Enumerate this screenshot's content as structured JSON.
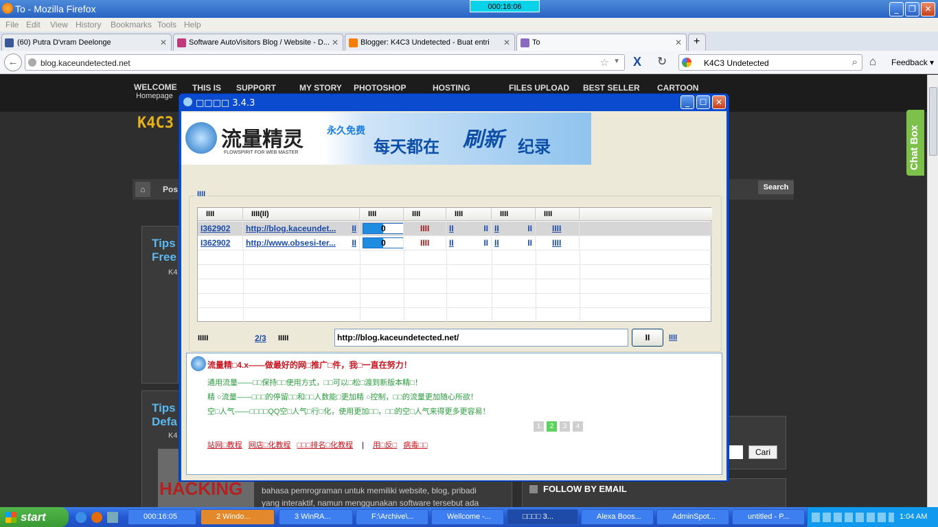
{
  "window": {
    "title": "To - Mozilla Firefox",
    "timer": "000:16:06"
  },
  "menu": [
    "File",
    "Edit",
    "View",
    "History",
    "Bookmarks",
    "Tools",
    "Help"
  ],
  "tabs": [
    {
      "label": "(60) Putra D'vram Deelonge",
      "color": "#3b5998"
    },
    {
      "label": "Software AutoVisitors Blog / Website - D...",
      "color": "#c0397a"
    },
    {
      "label": "Blogger: K4C3 Undetected - Buat entri",
      "color": "#f57d00"
    },
    {
      "label": "To",
      "color": "#8a6ac0"
    }
  ],
  "nav": {
    "url": "blog.kaceundetected.net",
    "search": "K4C3 Undetected",
    "feedback": "Feedback"
  },
  "site": {
    "topnav": [
      {
        "label": "WELCOME",
        "sub": "Homepage"
      },
      {
        "label": "THIS IS",
        "sub": ""
      },
      {
        "label": "SUPPORT",
        "sub": ""
      },
      {
        "label": "MY STORY",
        "sub": ""
      },
      {
        "label": "PHOTOSHOP",
        "sub": ""
      },
      {
        "label": "HOSTING",
        "sub": ""
      },
      {
        "label": "FILES UPLOAD",
        "sub": ""
      },
      {
        "label": "BEST SELLER",
        "sub": ""
      },
      {
        "label": "CARTOON",
        "sub": ""
      }
    ],
    "logo": "K4C3",
    "posts_tab": "Pos",
    "search_btn": "Search",
    "post1_title": "Tips\nFree",
    "post2_title": "Tips\nDefa",
    "post_author": "K4",
    "cari": "Cari",
    "follow": "FOLLOW BY EMAIL",
    "hacking": "HACKING",
    "excerpt1": "bahasa pemrograman untuk memiliki website, blog, pribadi",
    "excerpt2": "yang interaktif, namun menggunakan software tersebut ada",
    "chatbox": "Chat Box"
  },
  "dialog": {
    "title": "□□□□ 3.4.3",
    "banner_main": "流量精灵",
    "banner_free": "永久免费",
    "banner_sub": "FLOWSPIRIT FOR WEB MASTER",
    "banner_slogan": "每天都在",
    "banner_slogan2": "刷新",
    "banner_slogan3": "纪录",
    "group_label": "IIII",
    "headers": [
      "IIII",
      "IIII(II)",
      "IIII",
      "IIII",
      "IIII",
      "IIII",
      "IIII"
    ],
    "rows": [
      {
        "id": "I362902",
        "url": "http://blog.kaceundet...",
        "status": "II",
        "progress": "0",
        "fill": 0.5,
        "c4": "IIII",
        "c5a": "II",
        "c5b": "II",
        "c6a": "II",
        "c6b": "II",
        "c7": "IIII"
      },
      {
        "id": "I362902",
        "url": "http://www.obsesi-ter...",
        "status": "II",
        "progress": "0",
        "fill": 0.5,
        "c4": "IIII",
        "c5a": "II",
        "c5b": "II",
        "c6a": "II",
        "c6b": "II",
        "c7": "IIII"
      }
    ],
    "footer_label": "IIIII",
    "page_count": "2/3",
    "footer_label2": "IIIII",
    "url_input": "http://blog.kaceundetected.net/",
    "go_btn": "II",
    "go_link": "IIII",
    "info_title": "流量精□4.x——做最好的网□推广□件，我□一直在努力！",
    "info_lines": [
      "通用流量——□□保持□□使用方式，□□可以□松□渡到新版本精□！",
      "精 ○流量——□□□的停留□□和□□人数能□更加精 ○控制，□□的流量更加随心所欲！",
      "空□人气——□□□□QQ空□人气□行□化，使用更加□□，□□的空□人气来得更多更容易！"
    ],
    "pages": [
      "1",
      "2",
      "3",
      "4"
    ],
    "links": [
      "站网□教程",
      "网店□化教程",
      "□□□排名□化教程",
      "|",
      "用□反□",
      "病毒□□"
    ]
  },
  "taskbar": {
    "start": "start",
    "items": [
      "000:16:05",
      "2 Windo...",
      "3 WinRA...",
      "F:\\Archive\\...",
      "Wellcome -...",
      "□□□□ 3...",
      "Alexa Boos...",
      "AdminSpot...",
      "untitled - P..."
    ],
    "clock": "1:04 AM"
  }
}
